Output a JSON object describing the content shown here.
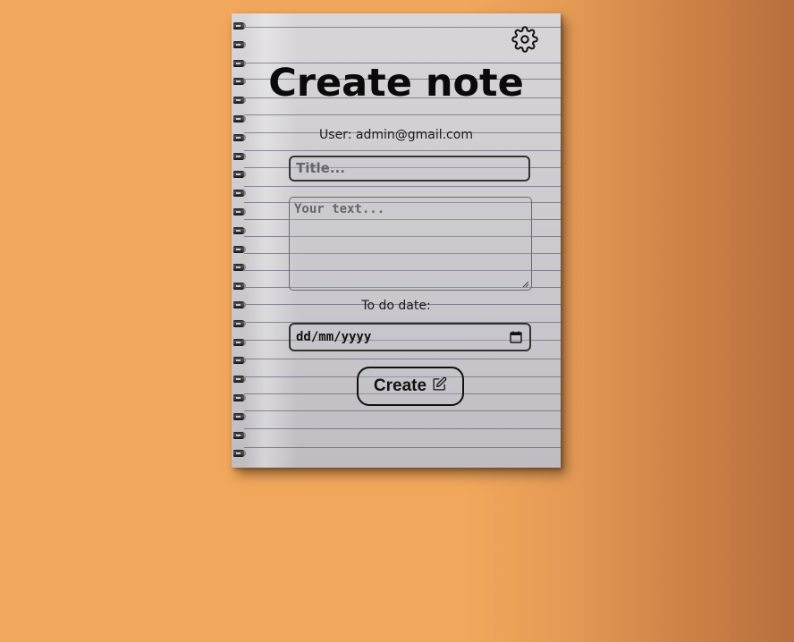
{
  "form": {
    "heading": "Create note",
    "user_text": "User: admin@gmail.com",
    "title_placeholder": "Title...",
    "text_placeholder": "Your text...",
    "date_label": "To do date:",
    "date_placeholder": "dd/mm/yyyy",
    "create_label": "Create"
  },
  "icons": {
    "settings": "gear-icon",
    "create": "edit-icon",
    "date": "calendar-icon"
  },
  "colors": {
    "background": "#f2a85c",
    "background_edge": "#b96f3d",
    "paper": "#d0ced1",
    "ink": "#0a0a0a"
  }
}
